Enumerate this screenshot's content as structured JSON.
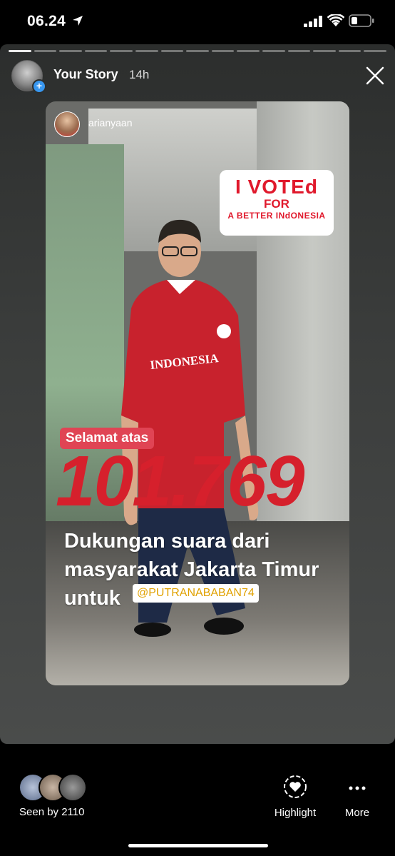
{
  "status_bar": {
    "time": "06.24"
  },
  "story": {
    "progress_total": 15,
    "progress_current": 1,
    "owner_label": "Your Story",
    "age": "14h",
    "card": {
      "username": "arianyaan",
      "sticker": {
        "line1": "I VOTEd",
        "line2": "FOR",
        "line3": "A BETTER INdONESIA"
      },
      "shirt_text": "INDONESIA",
      "selamat": "Selamat atas",
      "big_number": "101.769",
      "desc_line1": "Dukungan suara dari",
      "desc_line2": "masyarakat Jakarta Timur",
      "desc_line3": "untuk",
      "mention": "@PUTRANABABAN74"
    }
  },
  "bottom": {
    "seen_label": "Seen by 2110",
    "highlight_label": "Highlight",
    "more_label": "More"
  },
  "colors": {
    "accent_red": "#d6202c",
    "badge_blue": "#3897f0"
  }
}
